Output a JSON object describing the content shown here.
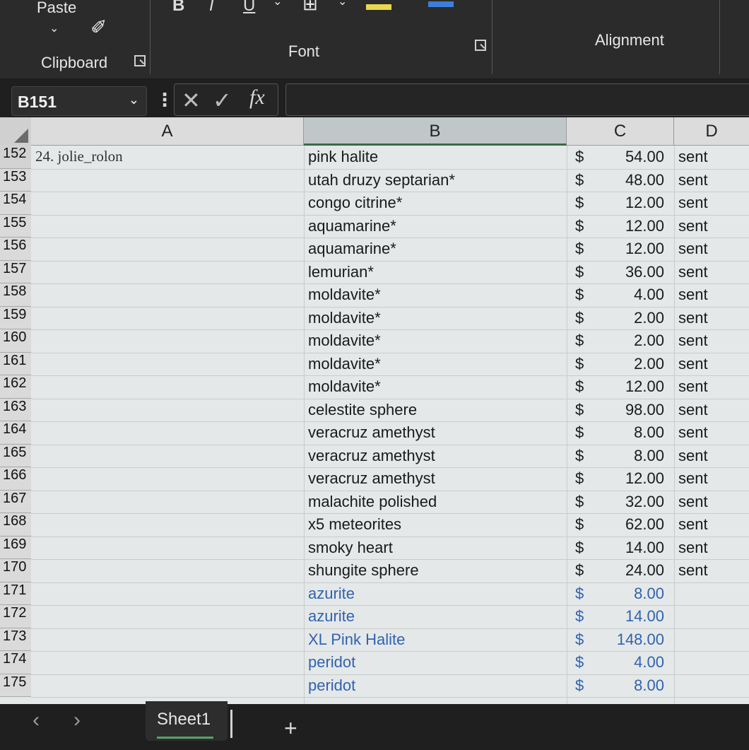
{
  "ribbon": {
    "paste_label": "Paste",
    "clipboard_label": "Clipboard",
    "font_label": "Font",
    "alignment_label": "Alignment",
    "bold_label": "B",
    "italic_label": "I",
    "underline_label": "U",
    "highlight_color": "#e8d84a",
    "font_color": "#3b7fd9"
  },
  "formula_bar": {
    "name_box": "B151",
    "fx_label": "fx",
    "formula_value": ""
  },
  "columns": [
    "A",
    "B",
    "C",
    "D"
  ],
  "rows": [
    {
      "num": "152",
      "a": "24. jolie_rolon",
      "b": "pink halite",
      "dollar": "$",
      "amount": "54.00",
      "d": "sent",
      "blue": false
    },
    {
      "num": "153",
      "a": "",
      "b": "utah druzy septarian*",
      "dollar": "$",
      "amount": "48.00",
      "d": "sent",
      "blue": false
    },
    {
      "num": "154",
      "a": "",
      "b": "congo citrine*",
      "dollar": "$",
      "amount": "12.00",
      "d": "sent",
      "blue": false
    },
    {
      "num": "155",
      "a": "",
      "b": "aquamarine*",
      "dollar": "$",
      "amount": "12.00",
      "d": "sent",
      "blue": false
    },
    {
      "num": "156",
      "a": "",
      "b": "aquamarine*",
      "dollar": "$",
      "amount": "12.00",
      "d": "sent",
      "blue": false
    },
    {
      "num": "157",
      "a": "",
      "b": "lemurian*",
      "dollar": "$",
      "amount": "36.00",
      "d": "sent",
      "blue": false
    },
    {
      "num": "158",
      "a": "",
      "b": "moldavite*",
      "dollar": "$",
      "amount": "4.00",
      "d": "sent",
      "blue": false
    },
    {
      "num": "159",
      "a": "",
      "b": "moldavite*",
      "dollar": "$",
      "amount": "2.00",
      "d": "sent",
      "blue": false
    },
    {
      "num": "160",
      "a": "",
      "b": "moldavite*",
      "dollar": "$",
      "amount": "2.00",
      "d": "sent",
      "blue": false
    },
    {
      "num": "161",
      "a": "",
      "b": "moldavite*",
      "dollar": "$",
      "amount": "2.00",
      "d": "sent",
      "blue": false
    },
    {
      "num": "162",
      "a": "",
      "b": "moldavite*",
      "dollar": "$",
      "amount": "12.00",
      "d": "sent",
      "blue": false
    },
    {
      "num": "163",
      "a": "",
      "b": "celestite sphere",
      "dollar": "$",
      "amount": "98.00",
      "d": "sent",
      "blue": false
    },
    {
      "num": "164",
      "a": "",
      "b": "veracruz amethyst",
      "dollar": "$",
      "amount": "8.00",
      "d": "sent",
      "blue": false
    },
    {
      "num": "165",
      "a": "",
      "b": "veracruz amethyst",
      "dollar": "$",
      "amount": "8.00",
      "d": "sent",
      "blue": false
    },
    {
      "num": "166",
      "a": "",
      "b": "veracruz amethyst",
      "dollar": "$",
      "amount": "12.00",
      "d": "sent",
      "blue": false
    },
    {
      "num": "167",
      "a": "",
      "b": "malachite polished",
      "dollar": "$",
      "amount": "32.00",
      "d": "sent",
      "blue": false
    },
    {
      "num": "168",
      "a": "",
      "b": "x5 meteorites",
      "dollar": "$",
      "amount": "62.00",
      "d": "sent",
      "blue": false
    },
    {
      "num": "169",
      "a": "",
      "b": "smoky heart",
      "dollar": "$",
      "amount": "14.00",
      "d": "sent",
      "blue": false
    },
    {
      "num": "170",
      "a": "",
      "b": "shungite sphere",
      "dollar": "$",
      "amount": "24.00",
      "d": "sent",
      "blue": false
    },
    {
      "num": "171",
      "a": "",
      "b": "azurite",
      "dollar": "$",
      "amount": "8.00",
      "d": "",
      "blue": true
    },
    {
      "num": "172",
      "a": "",
      "b": "azurite",
      "dollar": "$",
      "amount": "14.00",
      "d": "",
      "blue": true
    },
    {
      "num": "173",
      "a": "",
      "b": "XL Pink Halite",
      "dollar": "$",
      "amount": "148.00",
      "d": "",
      "blue": true
    },
    {
      "num": "174",
      "a": "",
      "b": "peridot",
      "dollar": "$",
      "amount": "4.00",
      "d": "",
      "blue": true
    },
    {
      "num": "175",
      "a": "",
      "b": "peridot",
      "dollar": "$",
      "amount": "8.00",
      "d": "",
      "blue": true
    }
  ],
  "sheet_tabs": {
    "active": "Sheet1",
    "add_label": "+"
  }
}
